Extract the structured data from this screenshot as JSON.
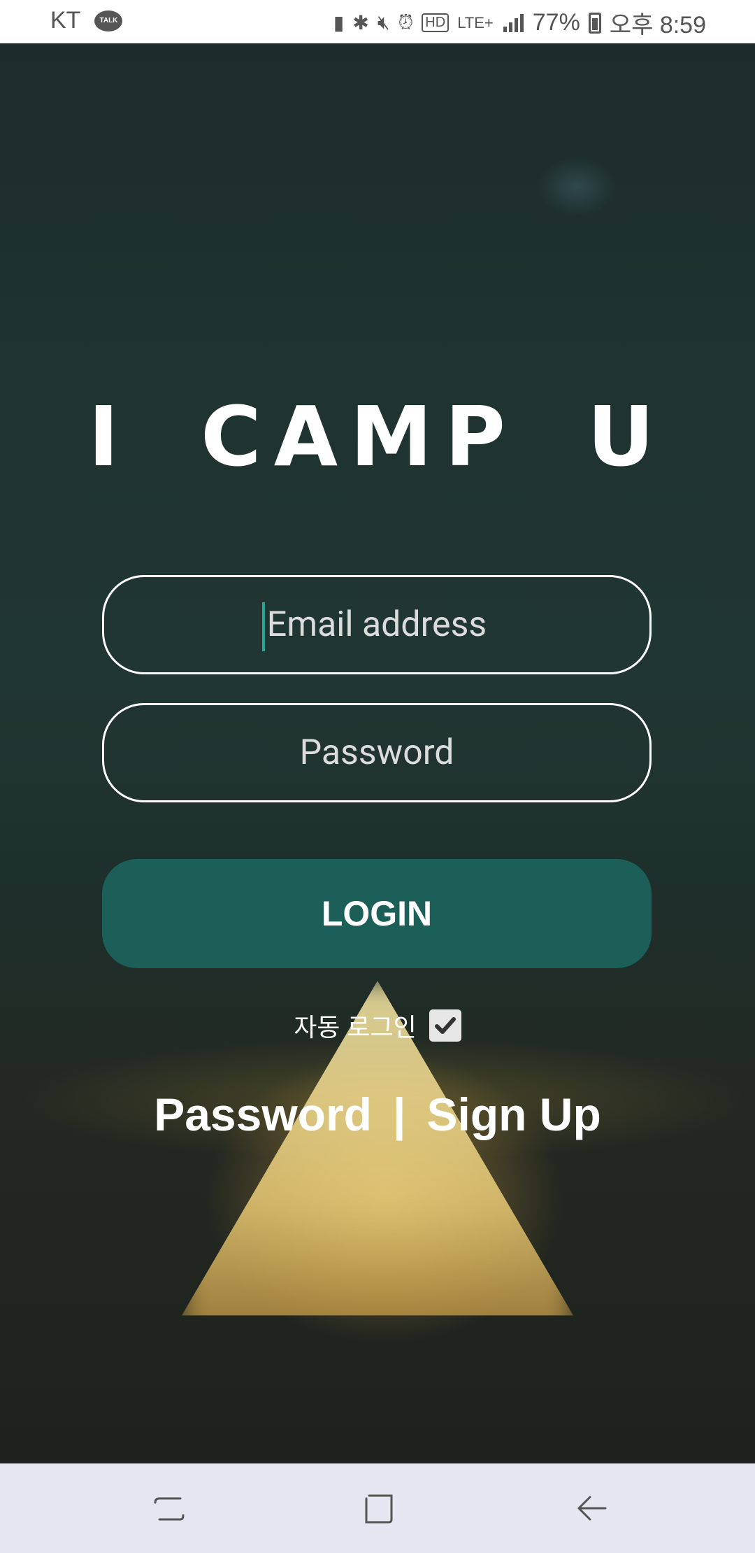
{
  "status_bar": {
    "carrier": "KT",
    "talk_badge": "TALK",
    "network": "LTE+",
    "battery": "77%",
    "time": "오후 8:59"
  },
  "app": {
    "logo": "I CAMP U"
  },
  "form": {
    "email_placeholder": "Email address",
    "password_placeholder": "Password",
    "login_label": "LOGIN",
    "auto_login_label": "자동 로그인",
    "auto_login_checked": true
  },
  "links": {
    "password": "Password",
    "separator": "|",
    "sign_up": "Sign Up"
  },
  "colors": {
    "accent": "#1b5f58",
    "caret": "#2aa593"
  }
}
